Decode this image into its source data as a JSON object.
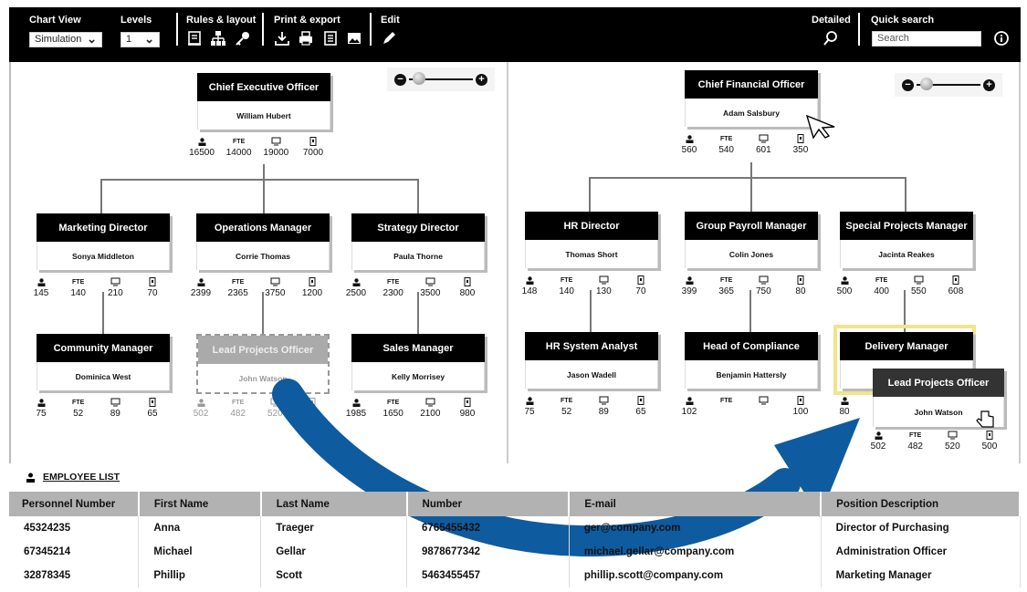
{
  "toolbar": {
    "chart_view": {
      "label": "Chart View",
      "value": "Simulation"
    },
    "levels": {
      "label": "Levels",
      "value": "1"
    },
    "rules_layout": {
      "label": "Rules & layout",
      "icons": [
        "clipboard-icon",
        "hierarchy-icon",
        "key-icon"
      ]
    },
    "print_export": {
      "label": "Print & export",
      "icons": [
        "download-icon",
        "print-icon",
        "document-icon",
        "image-icon"
      ]
    },
    "edit": {
      "label": "Edit",
      "icons": [
        "pencil-icon"
      ]
    },
    "detailed": {
      "label": "Detailed"
    },
    "quick_search": {
      "label": "Quick search",
      "placeholder": "Search"
    }
  },
  "stat_icons": [
    "person-icon",
    "FTE",
    "monitor-icon",
    "phone-icon"
  ],
  "left_chart": {
    "root": {
      "title": "Chief Executive Officer",
      "name": "William Hubert",
      "stats": [
        "16500",
        "14000",
        "19000",
        "7000"
      ]
    },
    "children": [
      {
        "title": "Marketing Director",
        "name": "Sonya Middleton",
        "stats": [
          "145",
          "140",
          "210",
          "70"
        ],
        "child": {
          "title": "Community Manager",
          "name": "Dominica West",
          "stats": [
            "75",
            "52",
            "89",
            "65"
          ]
        }
      },
      {
        "title": "Operations Manager",
        "name": "Corrie Thomas",
        "stats": [
          "2399",
          "2365",
          "3750",
          "1200"
        ],
        "child": {
          "title": "Lead Projects Officer",
          "name": "John Watson",
          "stats": [
            "502",
            "482",
            "520",
            "500"
          ]
        }
      },
      {
        "title": "Strategy Director",
        "name": "Paula Thorne",
        "stats": [
          "2500",
          "2300",
          "3500",
          "800"
        ],
        "child": {
          "title": "Sales Manager",
          "name": "Kelly Morrisey",
          "stats": [
            "1985",
            "1650",
            "2100",
            "980"
          ]
        }
      }
    ]
  },
  "right_chart": {
    "root": {
      "title": "Chief Financial Officer",
      "name": "Adam Salsbury",
      "stats": [
        "560",
        "540",
        "601",
        "350"
      ]
    },
    "children": [
      {
        "title": "HR Director",
        "name": "Thomas Short",
        "stats": [
          "148",
          "140",
          "130",
          "70"
        ],
        "child": {
          "title": "HR System Analyst",
          "name": "Jason Wadell",
          "stats": [
            "75",
            "52",
            "89",
            "65"
          ]
        }
      },
      {
        "title": "Group Payroll Manager",
        "name": "Colin Jones",
        "stats": [
          "399",
          "365",
          "750",
          "80"
        ],
        "child": {
          "title": "Head of Compliance",
          "name": "Benjamin Hattersly",
          "stats": [
            "102",
            "",
            "",
            "100"
          ]
        }
      },
      {
        "title": "Special Projects Manager",
        "name": "Jacinta Reakes",
        "stats": [
          "500",
          "400",
          "550",
          "608"
        ],
        "child": {
          "title": "Delivery Manager",
          "name": "",
          "stats": [
            "80",
            "",
            "",
            ""
          ]
        }
      }
    ],
    "dragged": {
      "title": "Lead Projects Officer",
      "name": "John Watson",
      "stats": [
        "502",
        "482",
        "520",
        "500"
      ]
    }
  },
  "employee_list": {
    "title": "EMPLOYEE LIST",
    "columns": [
      "Personnel Number",
      "First Name",
      "Last Name",
      "Number",
      "E-mail",
      "Position Description"
    ],
    "rows": [
      [
        "45324235",
        "Anna",
        "Traeger",
        "6765455432",
        "ger@company.com",
        "Director of Purchasing"
      ],
      [
        "67345214",
        "Michael",
        "Gellar",
        "9878677342",
        "michael.gellar@company.com",
        "Administration Officer"
      ],
      [
        "32878345",
        "Phillip",
        "Scott",
        "5463455457",
        "phillip.scott@company.com",
        "Marketing Manager"
      ]
    ]
  },
  "colors": {
    "toolbar": "#000000",
    "highlight": "#f3e38a",
    "arrow": "#0e5b9f",
    "header_row": "#b2b2b2"
  }
}
